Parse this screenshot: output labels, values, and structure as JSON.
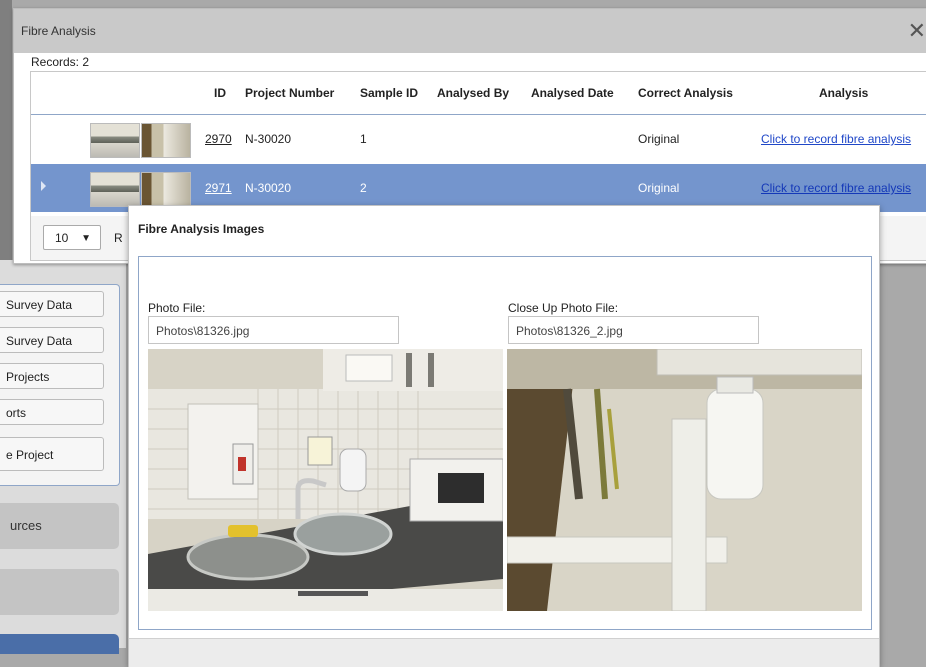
{
  "dialog": {
    "title": "Fibre Analysis",
    "close_glyph": "✕",
    "records_label": "Records: 2"
  },
  "grid": {
    "columns": [
      "ID",
      "Project Number",
      "Sample ID",
      "Analysed By",
      "Analysed Date",
      "Correct Analysis",
      "Analysis"
    ],
    "rows": [
      {
        "id": "2970",
        "project_number": "N-30020",
        "sample_id": "1",
        "analysed_by": "",
        "analysed_date": "",
        "correct_analysis": "Original",
        "analysis_link": "Click to record fibre analysis",
        "selected": false
      },
      {
        "id": "2971",
        "project_number": "N-30020",
        "sample_id": "2",
        "analysed_by": "",
        "analysed_date": "",
        "correct_analysis": "Original",
        "analysis_link": "Click to record fibre analysis",
        "selected": true
      }
    ],
    "pager": {
      "page_size": "10",
      "dropdown_glyph": "▼",
      "text_partial": "R"
    }
  },
  "popup": {
    "title": "Fibre Analysis Images",
    "photo_file_label": "Photo File:",
    "photo_file_value": "Photos\\81326.jpg",
    "closeup_file_label": "Close Up Photo File:",
    "closeup_file_value": "Photos\\81326_2.jpg"
  },
  "sidebar": {
    "buttons": [
      "Survey Data",
      "Survey Data",
      "Projects",
      "orts",
      "e Project"
    ],
    "blocks": [
      "urces",
      ""
    ]
  },
  "colors": {
    "selected_row": "#7495cd",
    "link": "#1f47c8",
    "header_border": "#8fa6c8"
  }
}
